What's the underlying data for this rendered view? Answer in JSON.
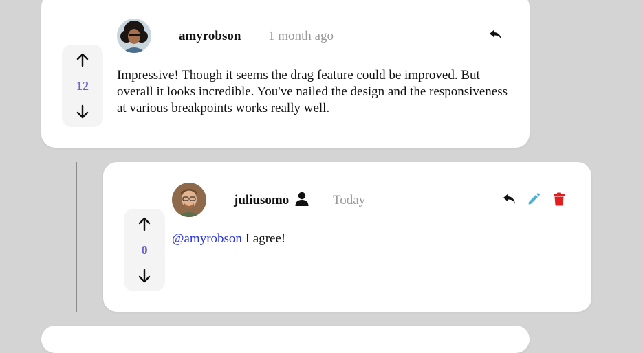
{
  "comments": [
    {
      "username": "amyrobson",
      "timestamp": "1 month ago",
      "score": "12",
      "body": "Impressive! Though it seems the drag feature could be improved. But overall it looks incredible. You've nailed the design and the responsiveness at various breakpoints works really well.",
      "actions": [
        "reply-icon"
      ]
    }
  ],
  "replies": [
    {
      "username": "juliusomo",
      "timestamp": "Today",
      "score": "0",
      "mention": "@amyrobson",
      "body": "I agree!",
      "is_current_user": true,
      "actions": [
        "reply-icon",
        "edit-icon",
        "delete-icon"
      ]
    }
  ],
  "colors": {
    "score": "#6a63c9",
    "mention": "#2a35d9",
    "edit": "#4fb0d6",
    "delete": "#e31e1e",
    "timestamp": "#9a9a9a",
    "background": "#d4d4d4"
  }
}
